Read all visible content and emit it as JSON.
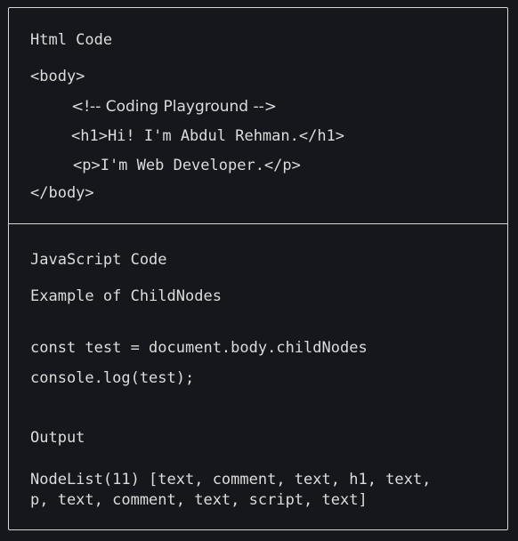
{
  "html_section": {
    "title": "Html Code",
    "lines": [
      "<body>",
      "<!-- Coding Playground -->",
      "<h1>Hi! I'm Abdul Rehman.</h1>",
      "<p>I'm Web Developer.</p>",
      "</body>"
    ]
  },
  "js_section": {
    "title": "JavaScript Code",
    "subtitle": "Example of ChildNodes",
    "code": [
      "const test = document.body.childNodes",
      "console.log(test);"
    ],
    "output_label": "Output",
    "output_lines": [
      "NodeList(11) [text, comment, text, h1, text,",
      "p, text, comment, text, script, text]"
    ]
  }
}
